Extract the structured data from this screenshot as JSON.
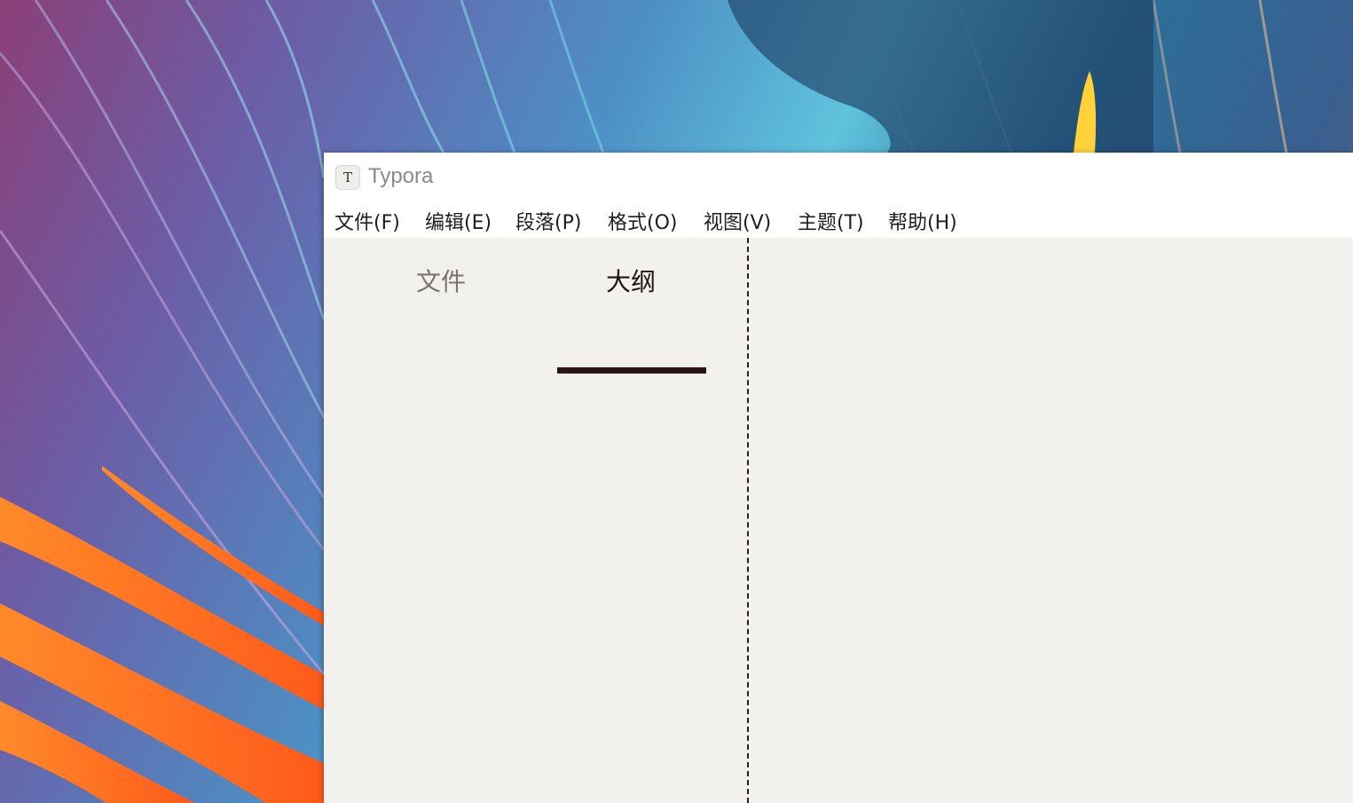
{
  "window": {
    "title": "Typora",
    "icon": "typora-icon",
    "icon_letter": "T"
  },
  "menu": {
    "items": [
      {
        "label": "文件(F)"
      },
      {
        "label": "编辑(E)"
      },
      {
        "label": "段落(P)"
      },
      {
        "label": "格式(O)"
      },
      {
        "label": "视图(V)"
      },
      {
        "label": "主题(T)"
      },
      {
        "label": "帮助(H)"
      }
    ]
  },
  "sidebar": {
    "tabs": [
      {
        "label": "文件",
        "active": false
      },
      {
        "label": "大纲",
        "active": true
      }
    ]
  },
  "colors": {
    "editor_background": "#f3f1ed",
    "active_tab_underline": "#2a1414",
    "sidebar_divider": "#2b1d1d"
  }
}
